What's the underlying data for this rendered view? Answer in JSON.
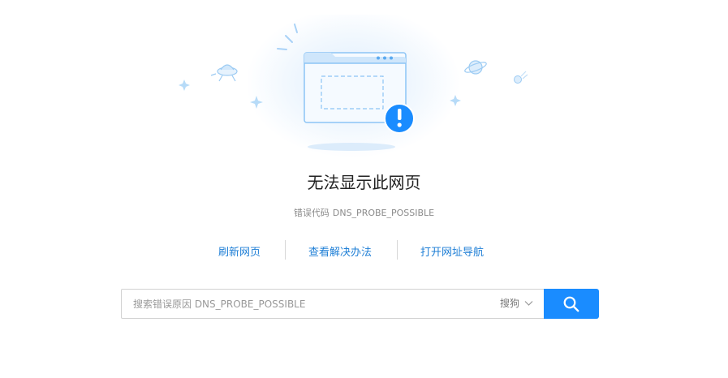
{
  "page": {
    "title": "无法显示此网页",
    "error_label": "错误代码",
    "error_code": "DNS_PROBE_POSSIBLE"
  },
  "links": [
    {
      "label": "刷新网页"
    },
    {
      "label": "查看解决办法"
    },
    {
      "label": "打开网址导航"
    }
  ],
  "search": {
    "placeholder": "搜索错误原因 DNS_PROBE_POSSIBLE",
    "engine": "搜狗",
    "button_icon": "search-icon"
  },
  "colors": {
    "accent": "#1a8cff",
    "link": "#1f7fd6",
    "illustration_blue": "#8cc4f5",
    "alert": "#1a8cff"
  },
  "icons": {
    "illustration": "browser-window-error-icon",
    "alert": "exclamation-icon",
    "decor": [
      "ufo-icon",
      "planet-icon",
      "meteor-icon",
      "sparkle-icon"
    ]
  }
}
